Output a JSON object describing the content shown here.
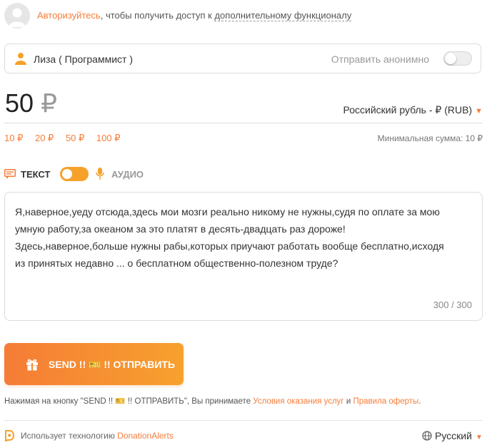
{
  "auth": {
    "link": "Авторизуйтесь",
    "middle": ", чтобы получить доступ к ",
    "dotted": "дополнительному функционалу"
  },
  "donor": {
    "name": "Лиза ( Программист )",
    "anonymous_label": "Отправить анонимно",
    "anonymous_enabled": false
  },
  "amount": {
    "value": "50",
    "symbol": "₽",
    "currency": "Российский рубль - ₽ (RUB)",
    "presets": [
      "10 ₽",
      "20 ₽",
      "50 ₽",
      "100 ₽"
    ],
    "min_label": "Минимальная сумма: 10 ₽"
  },
  "mode": {
    "text_label": "ТЕКСТ",
    "audio_label": "АУДИО",
    "selected": "text"
  },
  "message": {
    "text": "Я,наверное,уеду отсюда,здесь мои мозги реально никому не нужны,судя по оплате за мою\nумную работу,за океаном за это платят в десять-двадцать раз дороже!\nЗдесь,наверное,больше нужны рабы,которых приучают работать вообще бесплатно,исходя\nиз принятых недавно ... о бесплатном общественно-полезном труде?",
    "counter": "300 / 300"
  },
  "send": {
    "label": "SEND !! 🎫 !! ОТПРАВИТЬ"
  },
  "terms": {
    "prefix": "Нажимая на кнопку \"SEND !! 🎫 !! ОТПРАВИТЬ\", Вы принимаете ",
    "link1": "Условия оказания услуг",
    "and": " и ",
    "link2": "Правила оферты",
    "suffix": "."
  },
  "footer": {
    "prefix": "Использует технологию ",
    "link": "DonationAlerts",
    "language": "Русский"
  },
  "colors": {
    "accent": "#f57d3a",
    "button_gradient_start": "#f57c36",
    "button_gradient_end": "#f7a12e",
    "toggle_on": "#f5a12a"
  },
  "icons": [
    "avatar-placeholder-icon",
    "user-icon",
    "text-message-icon",
    "microphone-icon",
    "gift-icon",
    "donationalerts-logo-icon",
    "globe-icon",
    "chevron-down-icon"
  ]
}
